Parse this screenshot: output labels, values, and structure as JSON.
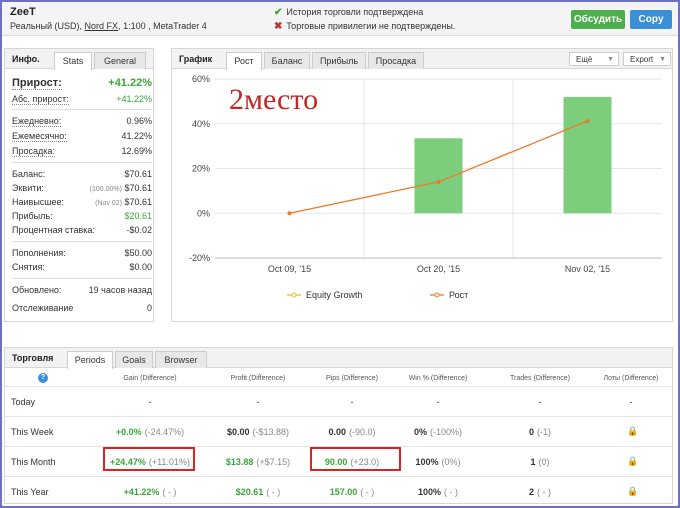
{
  "account": {
    "name": "ZeeT",
    "type": "Реальный (USD),",
    "broker": "Nord FX",
    "leverage": ", 1:100 , MetaTrader 4"
  },
  "verification": {
    "history": "История торговли подтверждена",
    "privileges": "Торговые привилегии не подтверждены."
  },
  "buttons": {
    "discuss": "Обсудить",
    "copy": "Copy"
  },
  "info": {
    "title": "Инфо.",
    "tabs": [
      "Stats",
      "General"
    ],
    "growth_label": "Прирост:",
    "growth_value": "+41.22%",
    "abs_growth_label": "Абс. прирост:",
    "abs_growth_value": "+41.22%",
    "daily_label": "Ежедневно:",
    "daily_value": "0.96%",
    "monthly_label": "Ежемесячно:",
    "monthly_value": "41.22%",
    "drawdown_label": "Просадка:",
    "drawdown_value": "12.69%",
    "balance_label": "Баланс:",
    "balance_value": "$70.61",
    "equity_label": "Эквити:",
    "equity_note": "(100.00%)",
    "equity_value": "$70.61",
    "highest_label": "Наивысшее:",
    "highest_note": "(Nov 02)",
    "highest_value": "$70.61",
    "profit_label": "Прибыль:",
    "profit_value": "$20.61",
    "interest_label": "Процентная ставка:",
    "interest_value": "-$0.02",
    "deposits_label": "Пополнения:",
    "deposits_value": "$50.00",
    "withdrawals_label": "Снятия:",
    "withdrawals_value": "$0.00",
    "updated_label": "Обновлено:",
    "updated_value": "19 часов назад",
    "tracking_label": "Отслеживание",
    "tracking_value": "0"
  },
  "chart_panel": {
    "title": "График",
    "tabs": [
      "Рост",
      "Баланс",
      "Прибыль",
      "Просадка"
    ],
    "more": "Ещё",
    "export": "Export",
    "annotation": "2место"
  },
  "chart_data": {
    "type": "bar",
    "categories": [
      "Oct 09, '15",
      "Oct 20, '15",
      "Nov 02, '15"
    ],
    "series": [
      {
        "name": "Equity Growth",
        "values": [
          0,
          14,
          41.2
        ]
      },
      {
        "name": "Рост",
        "values": [
          0,
          33.5,
          52
        ]
      }
    ],
    "ylim": [
      -20,
      60
    ],
    "yticks": [
      "60%",
      "40%",
      "20%",
      "0%",
      "-20%"
    ],
    "legend": [
      "Equity Growth",
      "Рост"
    ],
    "colors": {
      "bar": "#7ccd7c",
      "line": "#f07828",
      "equity": "#f0c020"
    }
  },
  "trading": {
    "title": "Торговля",
    "tabs": [
      "Periods",
      "Goals",
      "Browser"
    ],
    "help_icon": "help-icon",
    "headers": [
      "Gain (Difference)",
      "Profit (Difference)",
      "Pips (Difference)",
      "Win % (Difference)",
      "Trades (Difference)",
      "Лоты (Difference)"
    ],
    "rows": [
      {
        "label": "Today",
        "gain": "-",
        "gain_diff": "",
        "profit": "-",
        "profit_diff": "",
        "pips": "-",
        "pips_diff": "",
        "win": "-",
        "win_diff": "",
        "trades": "-",
        "trades_diff": "",
        "lots": "-"
      },
      {
        "label": "This Week",
        "gain": "+0.0%",
        "gain_diff": "(-24.47%)",
        "profit": "$0.00",
        "profit_diff": "(-$13.88)",
        "pips": "0.00",
        "pips_diff": "(-90.0)",
        "win": "0%",
        "win_diff": "(-100%)",
        "trades": "0",
        "trades_diff": "(-1)",
        "lots": "lock"
      },
      {
        "label": "This Month",
        "gain": "+24.47%",
        "gain_diff": "(+11.01%)",
        "profit": "$13.88",
        "profit_diff": "(+$7.15)",
        "pips": "90.00",
        "pips_diff": "(+23.0)",
        "win": "100%",
        "win_diff": "(0%)",
        "trades": "1",
        "trades_diff": "(0)",
        "lots": "lock"
      },
      {
        "label": "This Year",
        "gain": "+41.22%",
        "gain_diff": "( - )",
        "profit": "$20.61",
        "profit_diff": "( - )",
        "pips": "157.00",
        "pips_diff": "( - )",
        "win": "100%",
        "win_diff": "( - )",
        "trades": "2",
        "trades_diff": "( - )",
        "lots": "lock"
      }
    ]
  }
}
